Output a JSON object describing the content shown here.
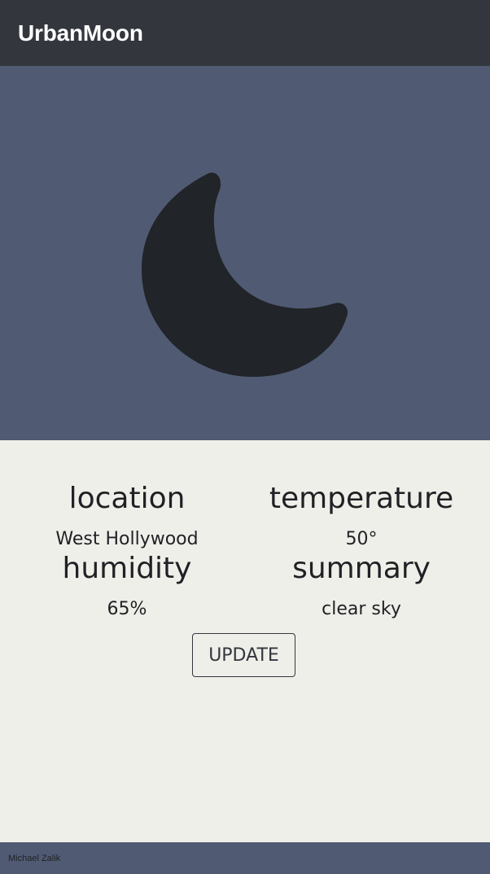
{
  "navbar": {
    "brand": "UrbanMoon"
  },
  "hero": {
    "icon": "moon-icon",
    "background": "#505a73",
    "icon_color": "#212428"
  },
  "stats": {
    "location": {
      "label": "location",
      "value": "West Hollywood"
    },
    "temperature": {
      "label": "temperature",
      "value": "50°"
    },
    "humidity": {
      "label": "humidity",
      "value": "65%"
    },
    "summary": {
      "label": "summary",
      "value": "clear sky"
    }
  },
  "actions": {
    "update_label": "UPDATE"
  },
  "footer": {
    "author": "Michael Zalik"
  },
  "colors": {
    "navbar": "#33373d",
    "page": "#efefea",
    "accent": "#505a73"
  }
}
